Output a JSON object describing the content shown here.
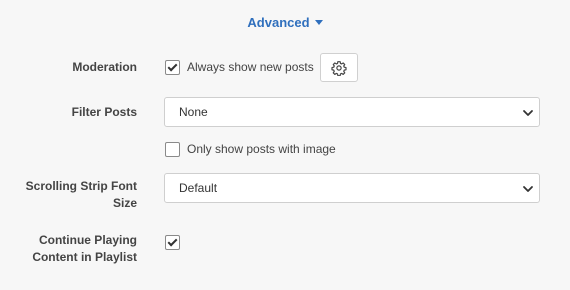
{
  "advanced": {
    "label": "Advanced"
  },
  "moderation": {
    "label": "Moderation",
    "checkbox_label": "Always show new posts",
    "checked": true
  },
  "filter_posts": {
    "label": "Filter Posts",
    "selected": "None",
    "image_only_label": "Only show posts with image",
    "image_only_checked": false
  },
  "font_size": {
    "label_line1": "Scrolling Strip Font",
    "label_line2": "Size",
    "selected": "Default"
  },
  "continue_playing": {
    "label_line1": "Continue Playing",
    "label_line2": "Content in Playlist",
    "checked": true
  },
  "colors": {
    "accent": "#2f6fbd",
    "background": "#f7f7f7"
  }
}
